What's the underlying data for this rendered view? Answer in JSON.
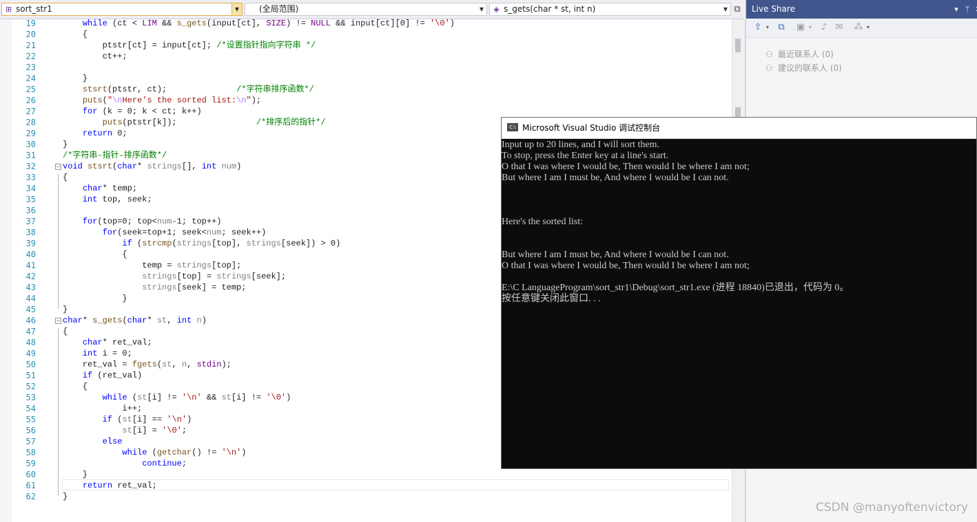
{
  "navbar": {
    "project": "sort_str1",
    "scope": "(全局范围)",
    "member": "s_gets(char * st, int n)",
    "split_icon": "split-window-icon"
  },
  "editor": {
    "lines": [
      {
        "n": "19",
        "segs": [
          [
            "    ",
            "p"
          ],
          [
            "while",
            "kw"
          ],
          [
            " (ct < ",
            "p"
          ],
          [
            "LIM",
            "mac"
          ],
          [
            " && ",
            "p"
          ],
          [
            "s_gets",
            "fn"
          ],
          [
            "(input[ct], ",
            "p"
          ],
          [
            "SIZE",
            "mac"
          ],
          [
            ") != ",
            "p"
          ],
          [
            "NULL",
            "mac"
          ],
          [
            " && input[ct][0] != ",
            "p"
          ],
          [
            "'\\0'",
            "st"
          ],
          [
            ")",
            "p"
          ]
        ]
      },
      {
        "n": "20",
        "segs": [
          [
            "    {",
            "p"
          ]
        ]
      },
      {
        "n": "21",
        "segs": [
          [
            "        ptstr[ct] = input[ct]; ",
            "p"
          ],
          [
            "/*设置指针指向字符串 */",
            "cm"
          ]
        ]
      },
      {
        "n": "22",
        "segs": [
          [
            "        ct++;",
            "p"
          ]
        ]
      },
      {
        "n": "23",
        "segs": [
          [
            "",
            "p"
          ]
        ]
      },
      {
        "n": "24",
        "segs": [
          [
            "    }",
            "p"
          ]
        ]
      },
      {
        "n": "25",
        "segs": [
          [
            "    ",
            "p"
          ],
          [
            "stsrt",
            "fn"
          ],
          [
            "(ptstr, ct);              ",
            "p"
          ],
          [
            "/*字符串排序函数*/",
            "cm"
          ]
        ]
      },
      {
        "n": "26",
        "segs": [
          [
            "    ",
            "p"
          ],
          [
            "puts",
            "fn"
          ],
          [
            "(",
            "p"
          ],
          [
            "\"",
            "st"
          ],
          [
            "\\n",
            "esc"
          ],
          [
            "Here's the sorted list:",
            "st"
          ],
          [
            "\\n",
            "esc"
          ],
          [
            "\"",
            "st"
          ],
          [
            ");",
            "p"
          ]
        ]
      },
      {
        "n": "27",
        "segs": [
          [
            "    ",
            "p"
          ],
          [
            "for",
            "kw"
          ],
          [
            " (k = 0; k < ct; k++)",
            "p"
          ]
        ]
      },
      {
        "n": "28",
        "segs": [
          [
            "        ",
            "p"
          ],
          [
            "puts",
            "fn"
          ],
          [
            "(ptstr[k]);                ",
            "p"
          ],
          [
            "/*排序后的指针*/",
            "cm"
          ]
        ]
      },
      {
        "n": "29",
        "segs": [
          [
            "    ",
            "p"
          ],
          [
            "return",
            "kw"
          ],
          [
            " 0;",
            "p"
          ]
        ]
      },
      {
        "n": "30",
        "segs": [
          [
            "}",
            "p"
          ]
        ]
      },
      {
        "n": "31",
        "segs": [
          [
            "/*字符串-指针-排序函数*/",
            "cm"
          ]
        ]
      },
      {
        "n": "32",
        "segs": [
          [
            "void",
            "kw"
          ],
          [
            " ",
            "p"
          ],
          [
            "stsrt",
            "fn"
          ],
          [
            "(",
            "p"
          ],
          [
            "char",
            "kw"
          ],
          [
            "* ",
            "p"
          ],
          [
            "strings",
            "par"
          ],
          [
            "[], ",
            "p"
          ],
          [
            "int",
            "kw"
          ],
          [
            " ",
            "p"
          ],
          [
            "num",
            "par"
          ],
          [
            ")",
            "p"
          ]
        ]
      },
      {
        "n": "33",
        "segs": [
          [
            "{",
            "p"
          ]
        ]
      },
      {
        "n": "34",
        "segs": [
          [
            "    ",
            "p"
          ],
          [
            "char",
            "kw"
          ],
          [
            "* temp;",
            "p"
          ]
        ]
      },
      {
        "n": "35",
        "segs": [
          [
            "    ",
            "p"
          ],
          [
            "int",
            "kw"
          ],
          [
            " top, seek;",
            "p"
          ]
        ]
      },
      {
        "n": "36",
        "segs": [
          [
            "",
            "p"
          ]
        ]
      },
      {
        "n": "37",
        "segs": [
          [
            "    ",
            "p"
          ],
          [
            "for",
            "kw"
          ],
          [
            "(top=0; top<",
            "p"
          ],
          [
            "num",
            "par"
          ],
          [
            "-1; top++)",
            "p"
          ]
        ]
      },
      {
        "n": "38",
        "segs": [
          [
            "        ",
            "p"
          ],
          [
            "for",
            "kw"
          ],
          [
            "(seek=top+1; seek<",
            "p"
          ],
          [
            "num",
            "par"
          ],
          [
            "; seek++)",
            "p"
          ]
        ]
      },
      {
        "n": "39",
        "segs": [
          [
            "            ",
            "p"
          ],
          [
            "if",
            "kw"
          ],
          [
            " (",
            "p"
          ],
          [
            "strcmp",
            "fn"
          ],
          [
            "(",
            "p"
          ],
          [
            "strings",
            "par"
          ],
          [
            "[top], ",
            "p"
          ],
          [
            "strings",
            "par"
          ],
          [
            "[seek]) > 0)",
            "p"
          ]
        ]
      },
      {
        "n": "40",
        "segs": [
          [
            "            {",
            "p"
          ]
        ]
      },
      {
        "n": "41",
        "segs": [
          [
            "                temp = ",
            "p"
          ],
          [
            "strings",
            "par"
          ],
          [
            "[top];",
            "p"
          ]
        ]
      },
      {
        "n": "42",
        "segs": [
          [
            "                ",
            "p"
          ],
          [
            "strings",
            "par"
          ],
          [
            "[top] = ",
            "p"
          ],
          [
            "strings",
            "par"
          ],
          [
            "[seek];",
            "p"
          ]
        ]
      },
      {
        "n": "43",
        "segs": [
          [
            "                ",
            "p"
          ],
          [
            "strings",
            "par"
          ],
          [
            "[seek] = temp;",
            "p"
          ]
        ]
      },
      {
        "n": "44",
        "segs": [
          [
            "            }",
            "p"
          ]
        ]
      },
      {
        "n": "45",
        "segs": [
          [
            "}",
            "p"
          ]
        ]
      },
      {
        "n": "46",
        "segs": [
          [
            "char",
            "kw"
          ],
          [
            "* ",
            "p"
          ],
          [
            "s_gets",
            "fn"
          ],
          [
            "(",
            "p"
          ],
          [
            "char",
            "kw"
          ],
          [
            "* ",
            "p"
          ],
          [
            "st",
            "par"
          ],
          [
            ", ",
            "p"
          ],
          [
            "int",
            "kw"
          ],
          [
            " ",
            "p"
          ],
          [
            "n",
            "par"
          ],
          [
            ")",
            "p"
          ]
        ]
      },
      {
        "n": "47",
        "segs": [
          [
            "{",
            "p"
          ]
        ]
      },
      {
        "n": "48",
        "segs": [
          [
            "    ",
            "p"
          ],
          [
            "char",
            "kw"
          ],
          [
            "* ret_val;",
            "p"
          ]
        ]
      },
      {
        "n": "49",
        "segs": [
          [
            "    ",
            "p"
          ],
          [
            "int",
            "kw"
          ],
          [
            " i = 0;",
            "p"
          ]
        ]
      },
      {
        "n": "50",
        "segs": [
          [
            "    ret_val = ",
            "p"
          ],
          [
            "fgets",
            "fn"
          ],
          [
            "(",
            "p"
          ],
          [
            "st",
            "par"
          ],
          [
            ", ",
            "p"
          ],
          [
            "n",
            "par"
          ],
          [
            ", ",
            "p"
          ],
          [
            "stdin",
            "mac"
          ],
          [
            ");",
            "p"
          ]
        ]
      },
      {
        "n": "51",
        "segs": [
          [
            "    ",
            "p"
          ],
          [
            "if",
            "kw"
          ],
          [
            " (ret_val)",
            "p"
          ]
        ]
      },
      {
        "n": "52",
        "segs": [
          [
            "    {",
            "p"
          ]
        ]
      },
      {
        "n": "53",
        "segs": [
          [
            "        ",
            "p"
          ],
          [
            "while",
            "kw"
          ],
          [
            " (",
            "p"
          ],
          [
            "st",
            "par"
          ],
          [
            "[i] != ",
            "p"
          ],
          [
            "'\\n'",
            "st"
          ],
          [
            " && ",
            "p"
          ],
          [
            "st",
            "par"
          ],
          [
            "[i] != ",
            "p"
          ],
          [
            "'\\0'",
            "st"
          ],
          [
            ")",
            "p"
          ]
        ]
      },
      {
        "n": "54",
        "segs": [
          [
            "            i++;",
            "p"
          ]
        ]
      },
      {
        "n": "55",
        "segs": [
          [
            "        ",
            "p"
          ],
          [
            "if",
            "kw"
          ],
          [
            " (",
            "p"
          ],
          [
            "st",
            "par"
          ],
          [
            "[i] == ",
            "p"
          ],
          [
            "'\\n'",
            "st"
          ],
          [
            ")",
            "p"
          ]
        ]
      },
      {
        "n": "56",
        "segs": [
          [
            "            ",
            "p"
          ],
          [
            "st",
            "par"
          ],
          [
            "[i] = ",
            "p"
          ],
          [
            "'\\0'",
            "st"
          ],
          [
            ";",
            "p"
          ]
        ]
      },
      {
        "n": "57",
        "segs": [
          [
            "        ",
            "p"
          ],
          [
            "else",
            "kw"
          ]
        ]
      },
      {
        "n": "58",
        "segs": [
          [
            "            ",
            "p"
          ],
          [
            "while",
            "kw"
          ],
          [
            " (",
            "p"
          ],
          [
            "getchar",
            "fn"
          ],
          [
            "() != ",
            "p"
          ],
          [
            "'\\n'",
            "st"
          ],
          [
            ")",
            "p"
          ]
        ]
      },
      {
        "n": "59",
        "segs": [
          [
            "                ",
            "p"
          ],
          [
            "continue",
            "kw"
          ],
          [
            ";",
            "p"
          ]
        ]
      },
      {
        "n": "60",
        "segs": [
          [
            "    }",
            "p"
          ]
        ]
      },
      {
        "n": "61",
        "segs": [
          [
            "    ",
            "p"
          ],
          [
            "return",
            "kw"
          ],
          [
            " ret_val;",
            "p"
          ]
        ]
      },
      {
        "n": "62",
        "segs": [
          [
            "}",
            "p"
          ]
        ]
      }
    ]
  },
  "liveshare": {
    "title": "Live Share",
    "recent_contacts": "最近联系人 (0)",
    "suggested_contacts": "建议的联系人 (0)"
  },
  "console": {
    "title": "Microsoft Visual Studio 调试控制台",
    "icon_label": "C:\\",
    "lines": [
      "Input up to 20 lines, and I will sort them.",
      "To stop, press the Enter key at a line's start.",
      "O that I was where I would be, Then would I be where I am not;",
      "But where I am I must be, And where I would be I can not.",
      "",
      "",
      "",
      "Here's the sorted list:",
      "",
      "",
      "But where I am I must be, And where I would be I can not.",
      "O that I was where I would be, Then would I be where I am not;",
      "",
      "E:\\C LanguageProgram\\sort_str1\\Debug\\sort_str1.exe (进程 18840)已退出，代码为 0。",
      "按任意键关闭此窗口. . ."
    ]
  },
  "watermark": "CSDN @manyoftenvictory"
}
